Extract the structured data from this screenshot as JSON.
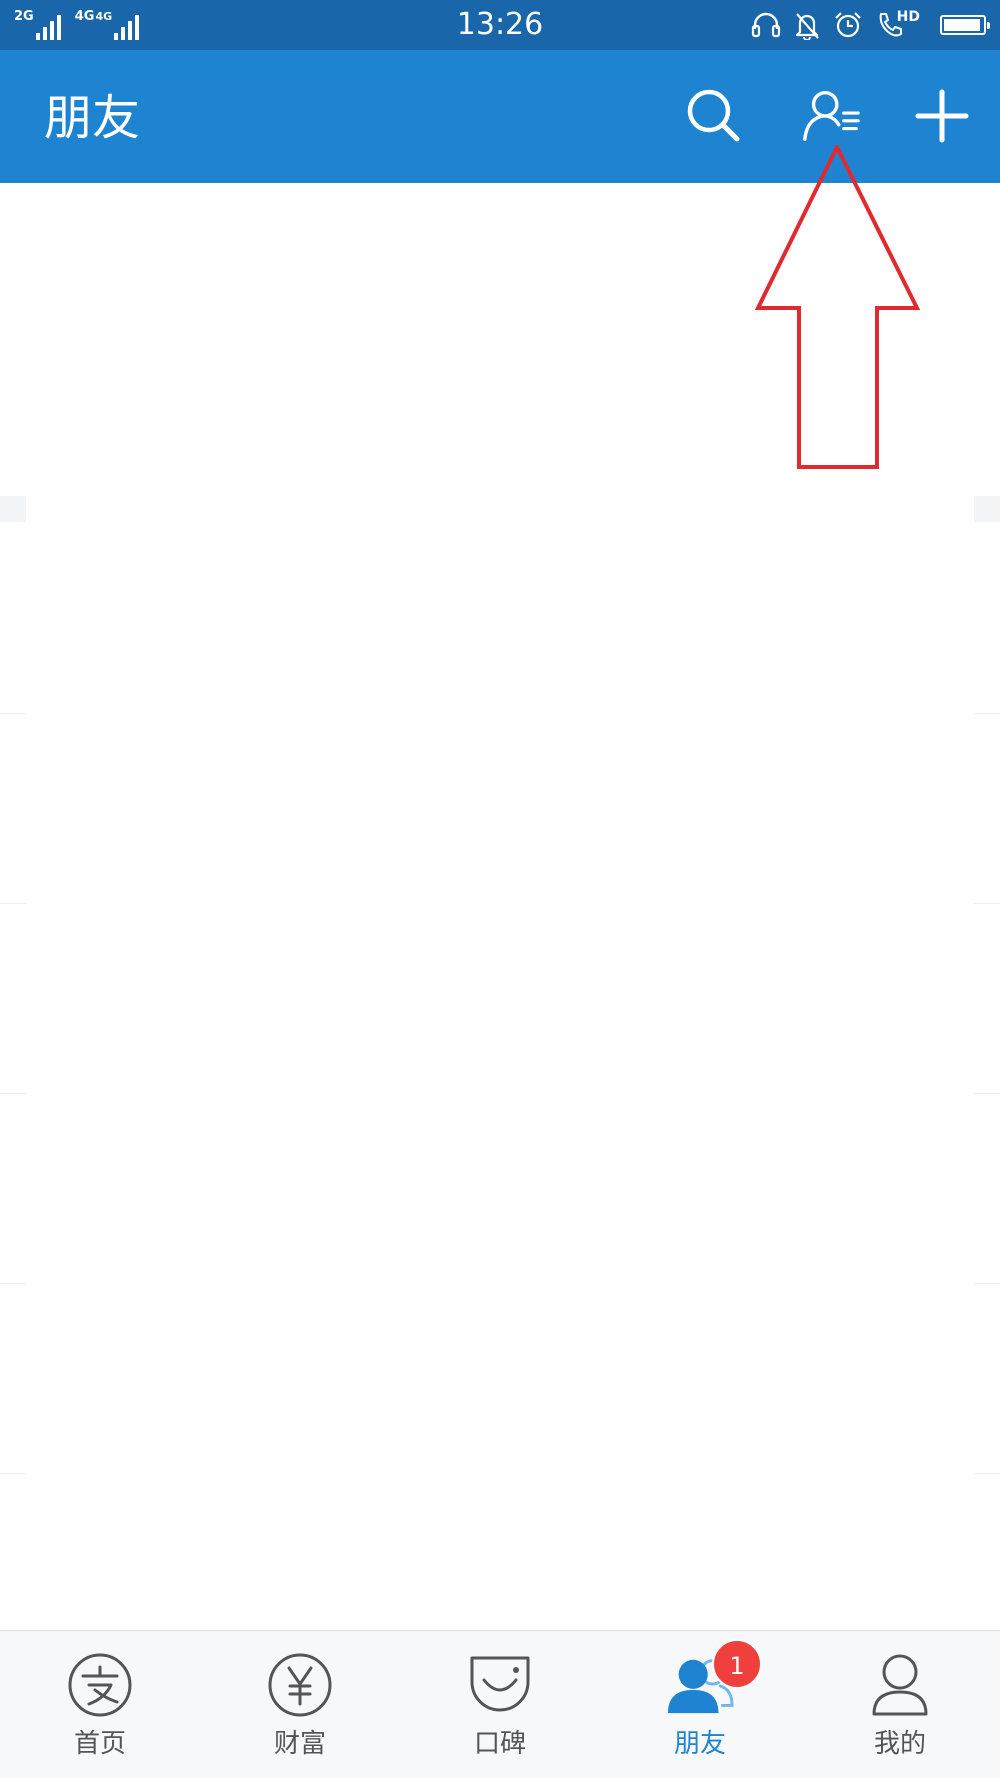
{
  "status_bar": {
    "sim1_network": "2G",
    "sim2_network_a": "4G",
    "sim2_network_b": "4G",
    "time": "13:26",
    "hd_label": "HD",
    "battery_level": 0.95,
    "icons": [
      "headset-icon",
      "bell-off-icon",
      "alarm-icon",
      "volte-call-icon",
      "battery-icon"
    ]
  },
  "header": {
    "title": "朋友",
    "actions": [
      {
        "name": "search",
        "icon": "search-icon"
      },
      {
        "name": "contacts",
        "icon": "contacts-list-icon"
      },
      {
        "name": "add",
        "icon": "plus-icon"
      }
    ]
  },
  "annotation": {
    "type": "arrow-up",
    "color": "#e02a2f",
    "points_to": "contacts-list-icon"
  },
  "tab_bar": {
    "active_index": 3,
    "tabs": [
      {
        "label": "首页",
        "icon": "alipay-logo-icon",
        "badge": ""
      },
      {
        "label": "财富",
        "icon": "yen-coin-icon",
        "badge": ""
      },
      {
        "label": "口碑",
        "icon": "koubei-smile-icon",
        "badge": ""
      },
      {
        "label": "朋友",
        "icon": "friends-icon",
        "badge": "1"
      },
      {
        "label": "我的",
        "icon": "person-outline-icon",
        "badge": ""
      }
    ]
  },
  "colors": {
    "status_bar_bg": "#1a66aa",
    "title_bar_bg": "#1e84d1",
    "active_tab": "#1e84d1",
    "badge": "#f0403e",
    "annotation": "#e02a2f"
  }
}
